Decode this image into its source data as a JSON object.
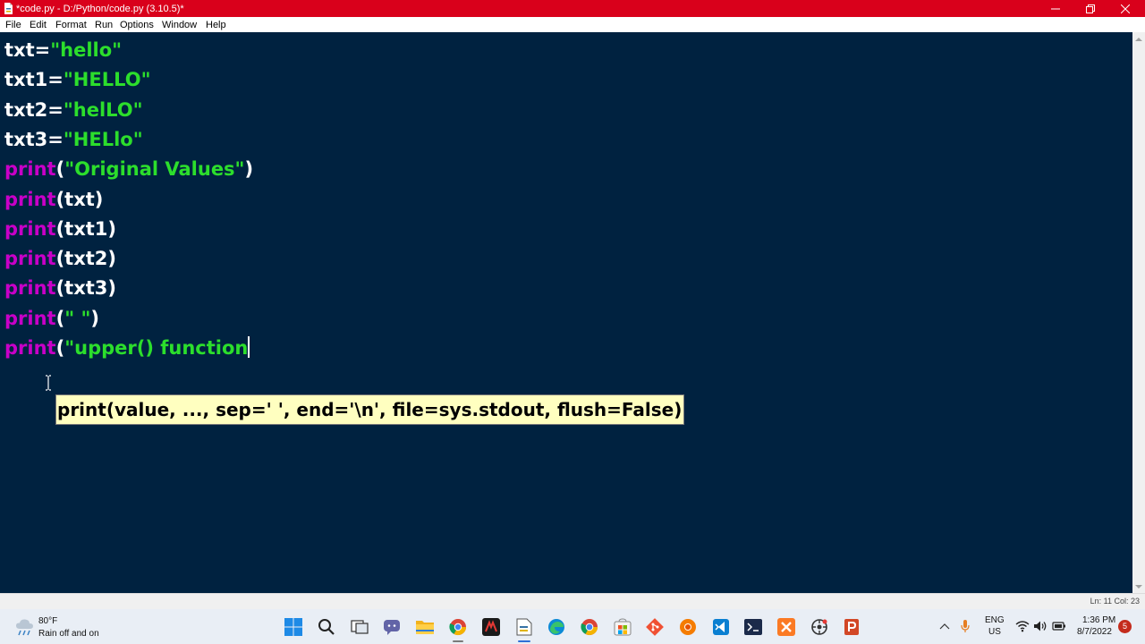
{
  "window": {
    "title": "*code.py - D:/Python/code.py (3.10.5)*",
    "titlebar_color": "#d9001b"
  },
  "menu": {
    "items": [
      "File",
      "Edit",
      "Format",
      "Run",
      "Options",
      "Window",
      "Help"
    ]
  },
  "editor": {
    "background": "#002240",
    "keyword_color": "#c800c8",
    "string_color": "#2cde2c",
    "lines": [
      [
        {
          "t": "txt=",
          "c": "plain"
        },
        {
          "t": "\"hello\"",
          "c": "str"
        }
      ],
      [
        {
          "t": "txt1=",
          "c": "plain"
        },
        {
          "t": "\"HELLO\"",
          "c": "str"
        }
      ],
      [
        {
          "t": "txt2=",
          "c": "plain"
        },
        {
          "t": "\"helLO\"",
          "c": "str"
        }
      ],
      [
        {
          "t": "txt3=",
          "c": "plain"
        },
        {
          "t": "\"HELlo\"",
          "c": "str"
        }
      ],
      [
        {
          "t": "print",
          "c": "kw"
        },
        {
          "t": "(",
          "c": "plain"
        },
        {
          "t": "\"Original Values\"",
          "c": "str"
        },
        {
          "t": ")",
          "c": "plain"
        }
      ],
      [
        {
          "t": "print",
          "c": "kw"
        },
        {
          "t": "(txt)",
          "c": "plain"
        }
      ],
      [
        {
          "t": "print",
          "c": "kw"
        },
        {
          "t": "(txt1)",
          "c": "plain"
        }
      ],
      [
        {
          "t": "print",
          "c": "kw"
        },
        {
          "t": "(txt2)",
          "c": "plain"
        }
      ],
      [
        {
          "t": "print",
          "c": "kw"
        },
        {
          "t": "(txt3)",
          "c": "plain"
        }
      ],
      [
        {
          "t": "print",
          "c": "kw"
        },
        {
          "t": "(",
          "c": "plain"
        },
        {
          "t": "\" \"",
          "c": "str"
        },
        {
          "t": ")",
          "c": "plain"
        }
      ],
      [
        {
          "t": "print",
          "c": "kw"
        },
        {
          "t": "(",
          "c": "plain"
        },
        {
          "t": "\"upper() function",
          "c": "str"
        }
      ]
    ],
    "calltip": "print(value, ..., sep=' ', end='\\n', file=sys.stdout, flush=False)"
  },
  "status": {
    "position": "Ln: 11   Col: 23"
  },
  "taskbar": {
    "weather_temp": "80°F",
    "weather_desc": "Rain off and on",
    "lang_top": "ENG",
    "lang_bottom": "US",
    "time": "1:36 PM",
    "date": "8/7/2022",
    "notification_count": "5",
    "icons": [
      "start-icon",
      "search-icon",
      "task-view-icon",
      "teams-chat-icon",
      "file-explorer-icon",
      "chrome-icon",
      "game-app-icon",
      "idle-editor-icon",
      "edge-icon",
      "chrome-alt-icon",
      "microsoft-store-icon",
      "git-icon",
      "chrome-profile-icon",
      "vscode-icon",
      "terminal-icon",
      "xampp-icon",
      "spyder-icon",
      "powerpoint-icon"
    ]
  }
}
